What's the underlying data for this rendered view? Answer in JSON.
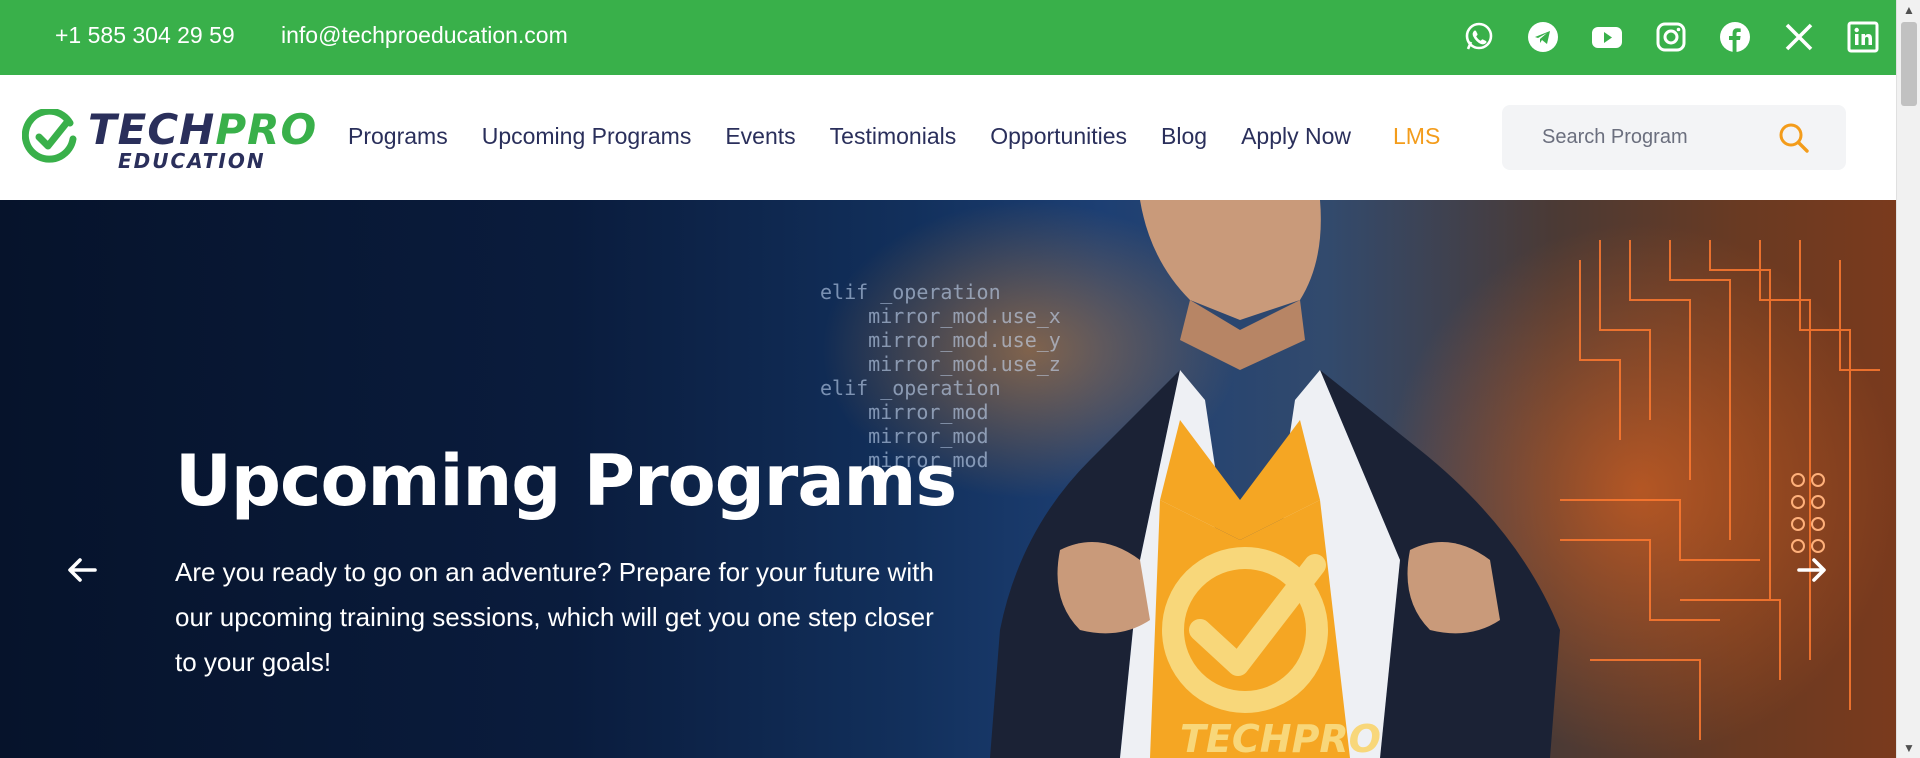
{
  "topbar": {
    "phone": "+1 585 304 29 59",
    "email": "info@techproeducation.com",
    "background": "#39b04a",
    "social_icons": [
      "whatsapp-icon",
      "telegram-icon",
      "youtube-icon",
      "instagram-icon",
      "facebook-icon",
      "x-icon",
      "linkedin-icon"
    ]
  },
  "logo": {
    "brand_dark": "TECH",
    "brand_green": "PRO",
    "subtitle": "EDUCATION"
  },
  "nav": {
    "items": [
      "Programs",
      "Upcoming Programs",
      "Events",
      "Testimonials",
      "Opportunities",
      "Blog",
      "Apply Now",
      "LMS"
    ]
  },
  "search": {
    "placeholder": "Search Program"
  },
  "hero": {
    "title": "Upcoming Programs",
    "description": "Are you ready to go on an adventure? Prepare for your future with our upcoming training sessions, which will get you one step closer to your goals!",
    "shirt_text": "TECHPRO"
  },
  "colors": {
    "navy": "#2a2f5b",
    "green": "#39b04a",
    "orange": "#f39c1b"
  }
}
